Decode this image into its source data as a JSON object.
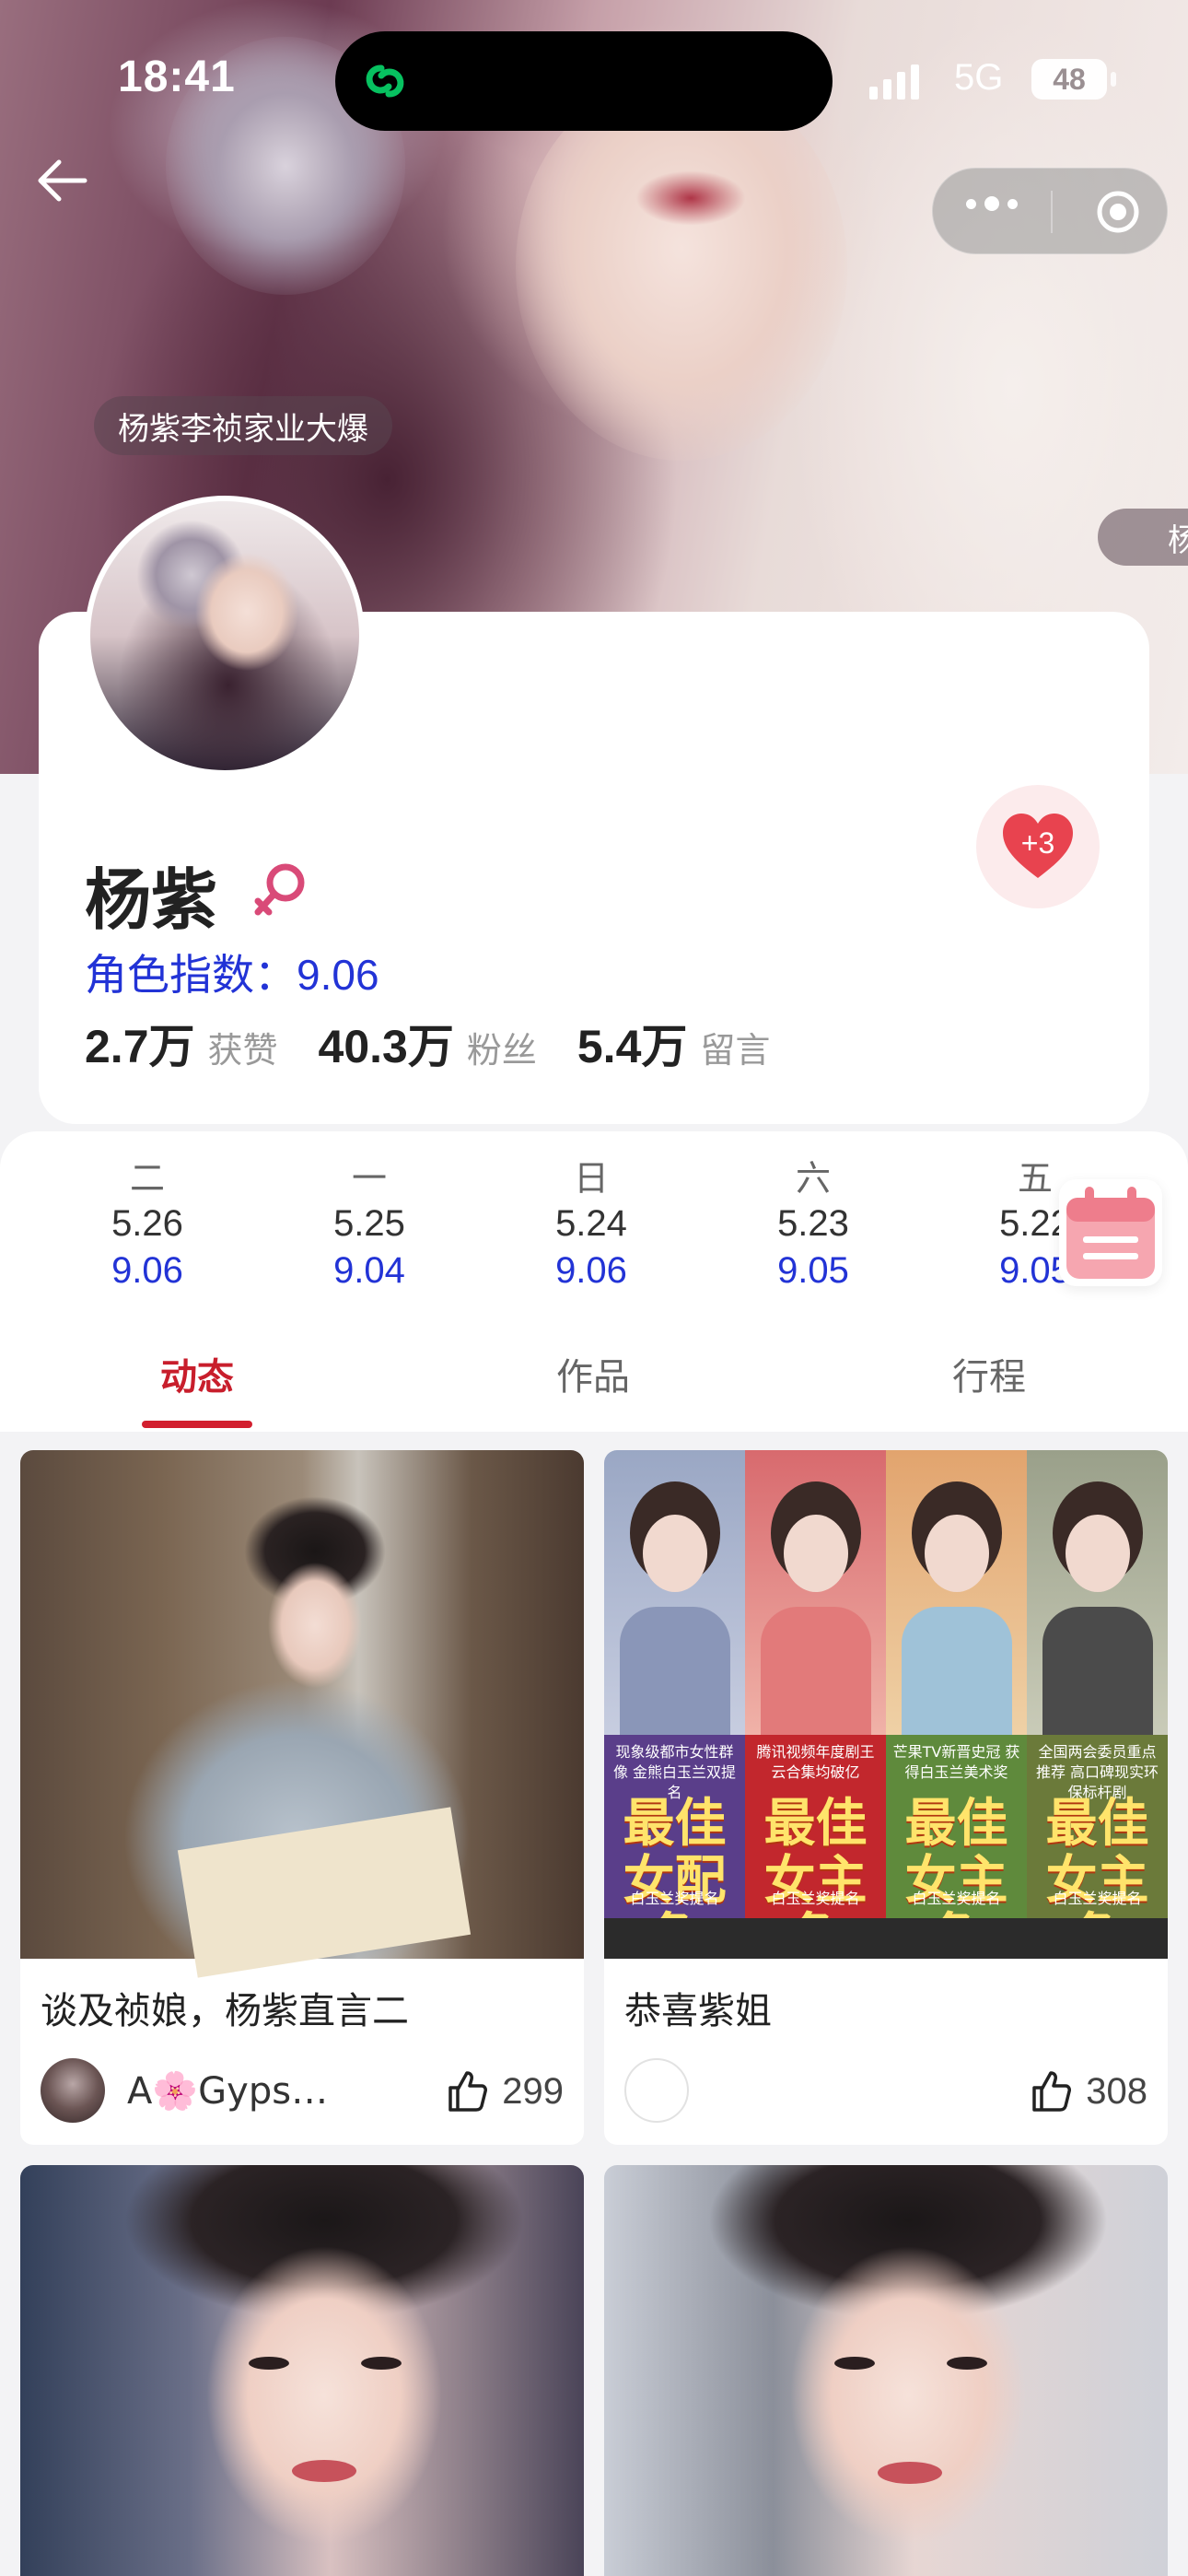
{
  "status_bar": {
    "time": "18:41",
    "network": "5G",
    "battery": "48"
  },
  "hero": {
    "danmu_left": "杨紫李祯家业大爆",
    "danmu_right": "杨"
  },
  "profile": {
    "name": "杨紫",
    "gender": "female",
    "role_index_label": "角色指数：",
    "role_index_value": "9.06",
    "like_bubble": "+3",
    "stats": [
      {
        "num": "2.7",
        "unit": "万",
        "label": "获赞"
      },
      {
        "num": "40.3",
        "unit": "万",
        "label": "粉丝"
      },
      {
        "num": "5.4",
        "unit": "万",
        "label": "留言"
      }
    ]
  },
  "dates": [
    {
      "dow": "二",
      "date": "5.26",
      "score": "9.06"
    },
    {
      "dow": "一",
      "date": "5.25",
      "score": "9.04"
    },
    {
      "dow": "日",
      "date": "5.24",
      "score": "9.06"
    },
    {
      "dow": "六",
      "date": "5.23",
      "score": "9.05"
    },
    {
      "dow": "五",
      "date": "5.22",
      "score": "9.05"
    }
  ],
  "tabs": [
    {
      "label": "动态",
      "active": true
    },
    {
      "label": "作品",
      "active": false
    },
    {
      "label": "行程",
      "active": false
    }
  ],
  "feed": [
    {
      "title": "谈及祯娘，杨紫直言二",
      "author": "A🌸Gyps…",
      "likes": "299"
    },
    {
      "title": "恭喜紫姐",
      "author": "",
      "likes": "308"
    }
  ],
  "posters": [
    {
      "sub": "现象级都市女性群像 金熊白玉兰双提名",
      "award": "最佳女配角",
      "foot": "白玉兰奖提名",
      "top": "#9aa7c4",
      "body": "#8a96b8",
      "mid": "#5a3e8a"
    },
    {
      "sub": "腾讯视频年度剧王 云合集均破亿",
      "award": "最佳女主角",
      "foot": "白玉兰奖提名",
      "top": "#d86a6e",
      "body": "#e27a7a",
      "mid": "#c2272d"
    },
    {
      "sub": "芒果TV新晋史冠 获得白玉兰美术奖",
      "award": "最佳女主角",
      "foot": "白玉兰奖提名",
      "top": "#e2a46e",
      "body": "#9fc2d8",
      "mid": "#5f8a3c"
    },
    {
      "sub": "全国两会委员重点推荐 高口碑现实环保标杆剧",
      "award": "最佳女主角",
      "foot": "白玉兰奖提名",
      "top": "#9aa08a",
      "body": "#4b4b4b",
      "mid": "#6b7a3a"
    }
  ],
  "colors": {
    "accent_red": "#d21f2f",
    "index_blue": "#2233d6",
    "wechat_green": "#07c160"
  }
}
